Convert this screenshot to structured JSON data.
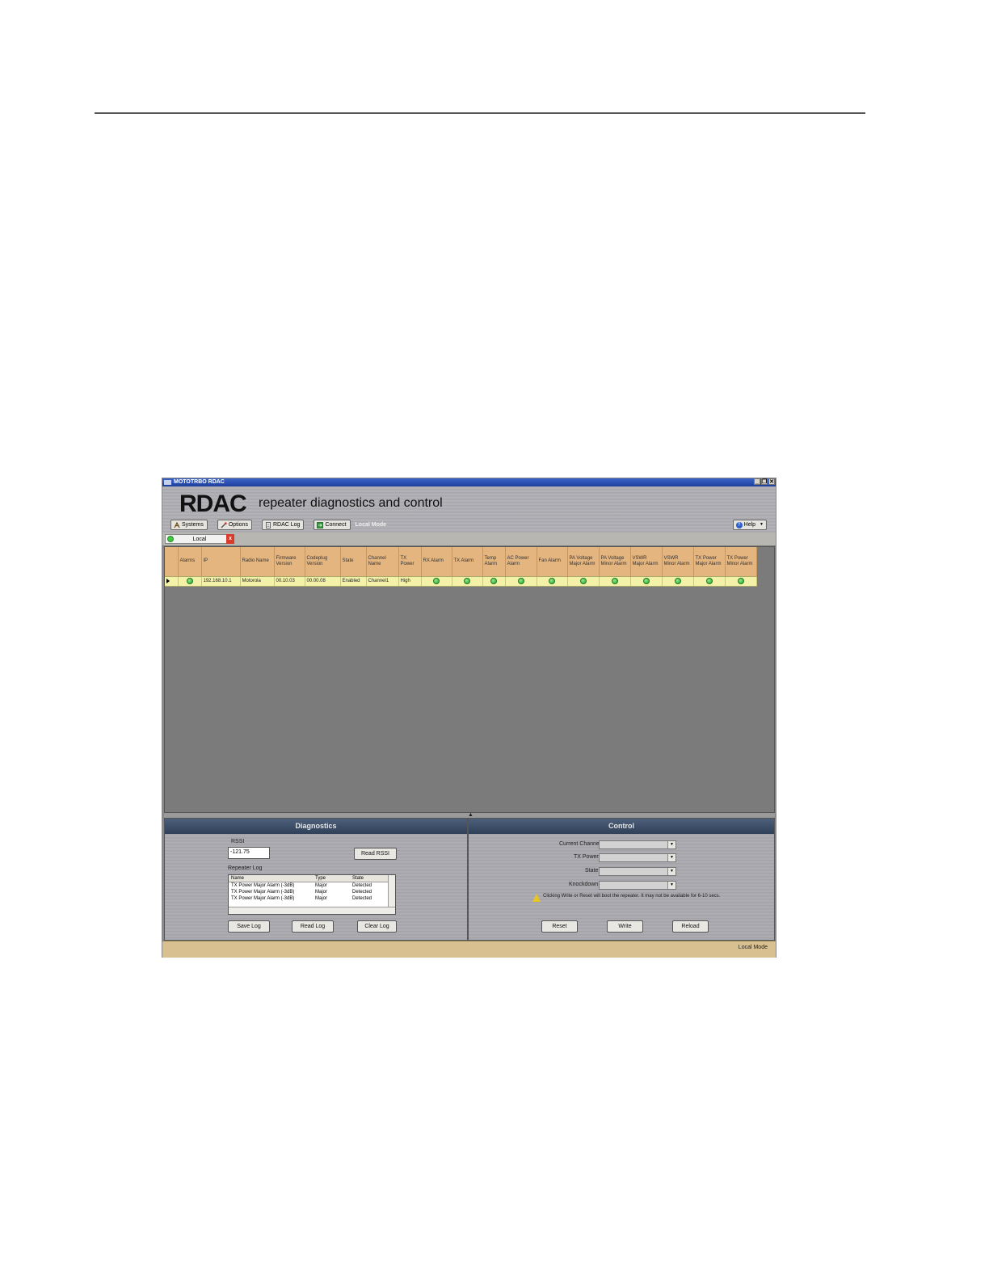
{
  "window": {
    "title": "MOTOTRBO RDAC",
    "controls": [
      "_",
      "❐",
      "✕"
    ]
  },
  "banner": {
    "logo_main": "RDAC",
    "logo_tagline": "repeater diagnostics and control"
  },
  "toolbar": {
    "items": [
      {
        "label": "Systems",
        "icon": "systems-icon"
      },
      {
        "label": "Options",
        "icon": "options-icon"
      },
      {
        "label": "RDAC Log",
        "icon": "log-icon"
      },
      {
        "label": "Connect",
        "icon": "connect-icon"
      }
    ],
    "mode": "Local Mode",
    "help": "Help"
  },
  "tab": {
    "label": "Local",
    "close": "x"
  },
  "grid": {
    "columns": [
      "Alarms",
      "IP",
      "Radio Name",
      "Firmware Version",
      "Codeplug Version",
      "State",
      "Channel Name",
      "TX Power",
      "RX Alarm",
      "TX Alarm",
      "Temp Alarm",
      "AC Power Alarm",
      "Fan Alarm",
      "PA Voltage Major Alarm",
      "PA Voltage Minor Alarm",
      "VSWR Major Alarm",
      "VSWR Minor Alarm",
      "TX Power Major Alarm",
      "TX Power Minor Alarm"
    ],
    "row": {
      "ip": "192.168.10.1",
      "radio_name": "Motorola",
      "firmware": "00.10.03",
      "codeplug": "00.00.08",
      "state": "Enabled",
      "channel": "Channel1",
      "tx_power": "High"
    },
    "status_color": "#2aa52a"
  },
  "diagnostics": {
    "title": "Diagnostics",
    "rssi_label": "RSSI",
    "rssi_value": "-121.75",
    "read_rssi": "Read RSSI",
    "log_label": "Repeater Log",
    "log_columns": [
      "Name",
      "Type",
      "State"
    ],
    "log_rows": [
      [
        "TX Power Major Alarm (-3dB)",
        "Major",
        "Detected"
      ],
      [
        "TX Power Major Alarm (-3dB)",
        "Major",
        "Detected"
      ],
      [
        "TX Power Major Alarm (-3dB)",
        "Major",
        "Detected"
      ]
    ],
    "save_log": "Save Log",
    "read_log": "Read Log",
    "clear_log": "Clear Log"
  },
  "control": {
    "title": "Control",
    "current_channel": "Current Channel",
    "tx_power": "TX Power",
    "state": "State",
    "knockdown": "Knockdown",
    "warning": "Clicking Write or Reset will boot the repeater. It may not be available for 6-10 secs.",
    "reset": "Reset",
    "write": "Write",
    "reload": "Reload"
  },
  "status": {
    "text": "Local Mode"
  }
}
